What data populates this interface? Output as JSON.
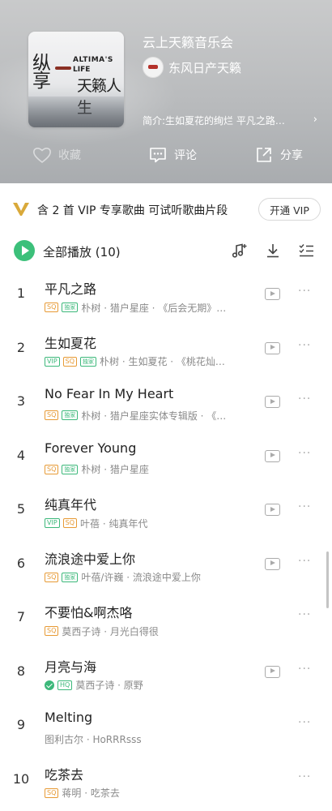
{
  "playlist": {
    "title": "云上天籁音乐会",
    "artist": "东风日产天籁",
    "intro": "简介:生如夏花的绚烂 平凡之路…",
    "cover": {
      "big_text": "纵\n享",
      "en1": "ALTIMA'S",
      "en2": "LIFE",
      "cn": "天籁人生"
    }
  },
  "actions": {
    "favorite": "收藏",
    "comment": "评论",
    "share": "分享"
  },
  "vip_bar": {
    "text": "含 2 首 VIP 专享歌曲 可试听歌曲片段",
    "button": "开通 VIP"
  },
  "play_all": {
    "label": "全部播放",
    "count": "(10)"
  },
  "tags": {
    "sq": "SQ",
    "exclusive": "独家",
    "vip": "VIP",
    "hq": "HQ"
  },
  "more_glyph": "···",
  "songs": [
    {
      "num": "1",
      "name": "平凡之路",
      "meta": "朴树 · 猎户星座 · 《后会无期》…",
      "tags": [
        "sq",
        "ex"
      ],
      "mv": true,
      "check": false
    },
    {
      "num": "2",
      "name": "生如夏花",
      "meta": "朴树 · 生如夏花 · 《桃花灿…",
      "tags": [
        "vip",
        "sq",
        "ex"
      ],
      "mv": true,
      "check": false
    },
    {
      "num": "3",
      "name": "No Fear In My Heart",
      "meta": "朴树 · 猎户星座实体专辑版 · 《…",
      "tags": [
        "sq",
        "ex"
      ],
      "mv": true,
      "check": false
    },
    {
      "num": "4",
      "name": "Forever Young",
      "meta": "朴树 · 猎户星座",
      "tags": [
        "sq",
        "ex"
      ],
      "mv": true,
      "check": false
    },
    {
      "num": "5",
      "name": "纯真年代",
      "meta": "叶蓓 · 纯真年代",
      "tags": [
        "vip",
        "sq"
      ],
      "mv": true,
      "check": false
    },
    {
      "num": "6",
      "name": "流浪途中爱上你",
      "meta": "叶蓓/许巍 · 流浪途中爱上你",
      "tags": [
        "sq",
        "ex"
      ],
      "mv": true,
      "check": false
    },
    {
      "num": "7",
      "name": "不要怕&啊杰咯",
      "meta": "莫西子诗 · 月光白得很",
      "tags": [
        "sq"
      ],
      "mv": false,
      "check": false
    },
    {
      "num": "8",
      "name": "月亮与海",
      "meta": "莫西子诗 · 原野",
      "tags": [
        "hq"
      ],
      "mv": true,
      "check": true
    },
    {
      "num": "9",
      "name": "Melting",
      "meta": "图利古尔 · HoRRRsss",
      "tags": [],
      "mv": false,
      "check": false
    },
    {
      "num": "10",
      "name": "吃茶去",
      "meta": "蒋明 · 吃茶去",
      "tags": [
        "sq"
      ],
      "mv": false,
      "check": false
    }
  ],
  "colors": {
    "accent": "#3cc07a",
    "sq_tag": "#e79a35",
    "vip_logo": "#d9a93a"
  }
}
